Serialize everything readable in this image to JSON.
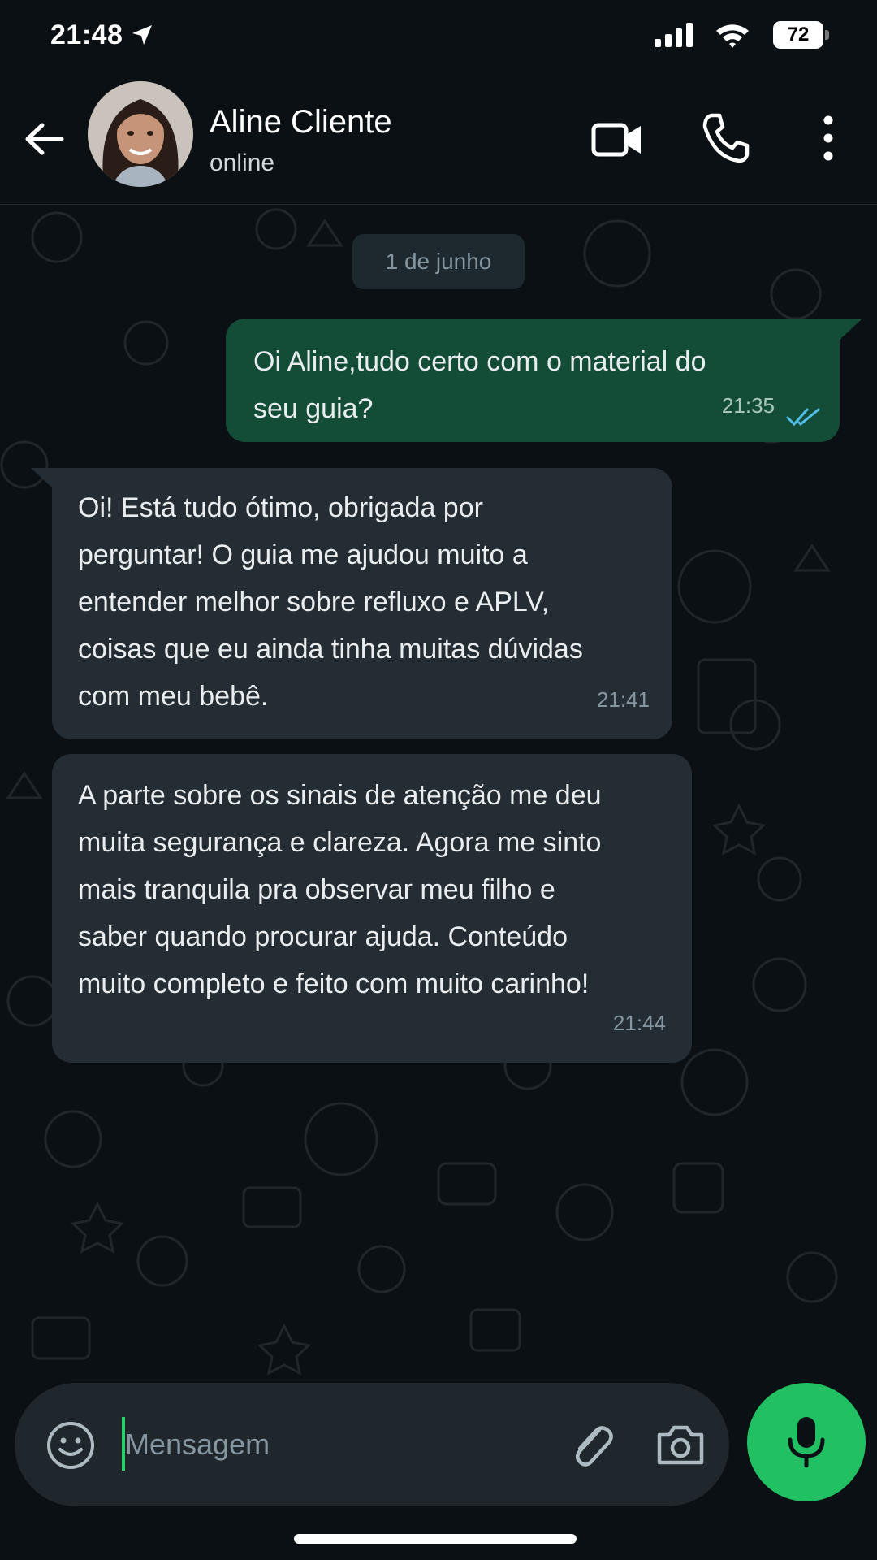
{
  "status_bar": {
    "time": "21:48",
    "battery": "72"
  },
  "header": {
    "contact_name": "Aline Cliente",
    "contact_status": "online"
  },
  "chat": {
    "date_chip": "1 de junho",
    "messages": [
      {
        "direction": "outgoing",
        "text": "Oi Aline,tudo certo com o material do\nseu guia?",
        "time": "21:35",
        "status": "read"
      },
      {
        "direction": "incoming",
        "text": "Oi! Está tudo ótimo, obrigada por\nperguntar! O guia me ajudou muito a\nentender melhor sobre refluxo e APLV,\ncoisas que eu ainda tinha muitas dúvidas\ncom meu bebê.",
        "time": "21:41"
      },
      {
        "direction": "incoming",
        "text": "A parte sobre os sinais de atenção me deu\nmuita segurança e clareza. Agora me sinto\nmais tranquila pra observar meu filho e\nsaber quando procurar ajuda. Conteúdo\nmuito completo e feito com muito carinho!",
        "time": "21:44"
      }
    ]
  },
  "composer": {
    "placeholder": "Mensagem",
    "value": ""
  },
  "colors": {
    "outgoing_bubble": "#144d37",
    "incoming_bubble": "#242d33",
    "read_ticks": "#53bdeb",
    "mic_button": "#21c063",
    "background": "#0b1014"
  },
  "icons": [
    "location-arrow-icon",
    "signal-icon",
    "wifi-icon",
    "back-arrow-icon",
    "video-call-icon",
    "phone-icon",
    "more-vert-icon",
    "emoji-icon",
    "attach-icon",
    "camera-icon",
    "mic-icon",
    "double-check-icon"
  ]
}
